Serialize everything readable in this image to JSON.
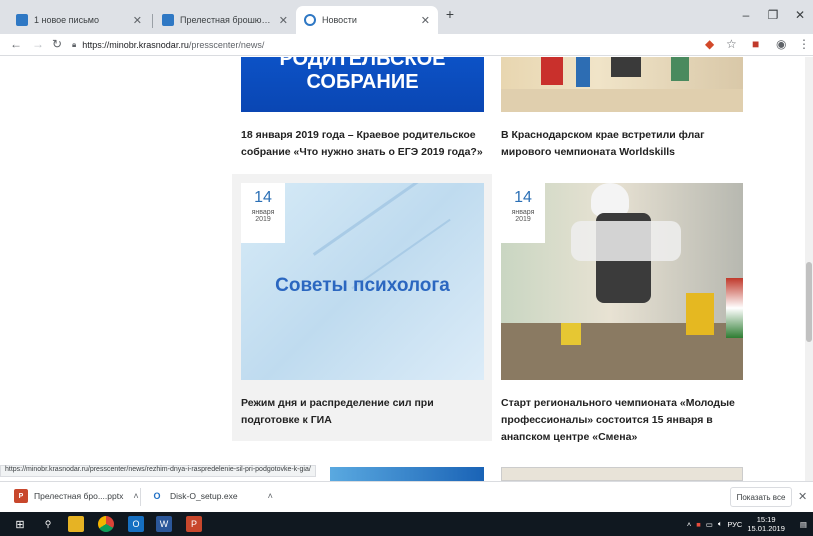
{
  "tabs": [
    {
      "title": "1 новое письмо",
      "favicon_color": "#2f78c4"
    },
    {
      "title": "Прелестная брошюра в презен",
      "favicon_color": "#2f78c4"
    },
    {
      "title": "Новости",
      "favicon_color": "#2f78c4",
      "active": true
    }
  ],
  "window": {
    "minimize": "–",
    "maximize": "❐",
    "close": "✕",
    "new_tab": "+"
  },
  "toolbar": {
    "url_host": "https://minobr.krasnodar.ru",
    "url_path": "/presscenter/news/"
  },
  "news": {
    "top_left": {
      "banner_lines": [
        "РОДИТЕЛЬСКОЕ",
        "СОБРАНИЕ"
      ],
      "title": "18 января 2019 года – Краевое родительское собрание «Что нужно знать о ЕГЭ 2019 года?»"
    },
    "top_right": {
      "title": "В Краснодарском крае встретили флаг мирового чемпионата Worldskills"
    },
    "mid_left": {
      "day": "14",
      "month": "января",
      "year": "2019",
      "banner": "Советы психолога",
      "title": "Режим дня и распределение сил при подготовке к ГИА"
    },
    "mid_right": {
      "day": "14",
      "month": "января",
      "year": "2019",
      "title": "Старт регионального чемпионата «Молодые профессионалы» состоится 15 января в анапском центре «Смена»"
    }
  },
  "status_url": "https://minobr.krasnodar.ru/presscenter/news/rezhim-dnya-i-raspredelenie-sil-pri-podgotovke-k-gia/",
  "downloads": [
    {
      "name": "Прелестная бро....pptx",
      "icon": "P",
      "color": "#c8472c"
    },
    {
      "name": "Disk-O_setup.exe",
      "icon": "O",
      "color": "#1f6fc4"
    }
  ],
  "shelf": {
    "show_all": "Показать все",
    "close": "✕"
  },
  "tray": {
    "lang": "РУС",
    "time": "15:19",
    "date": "15.01.2019"
  }
}
